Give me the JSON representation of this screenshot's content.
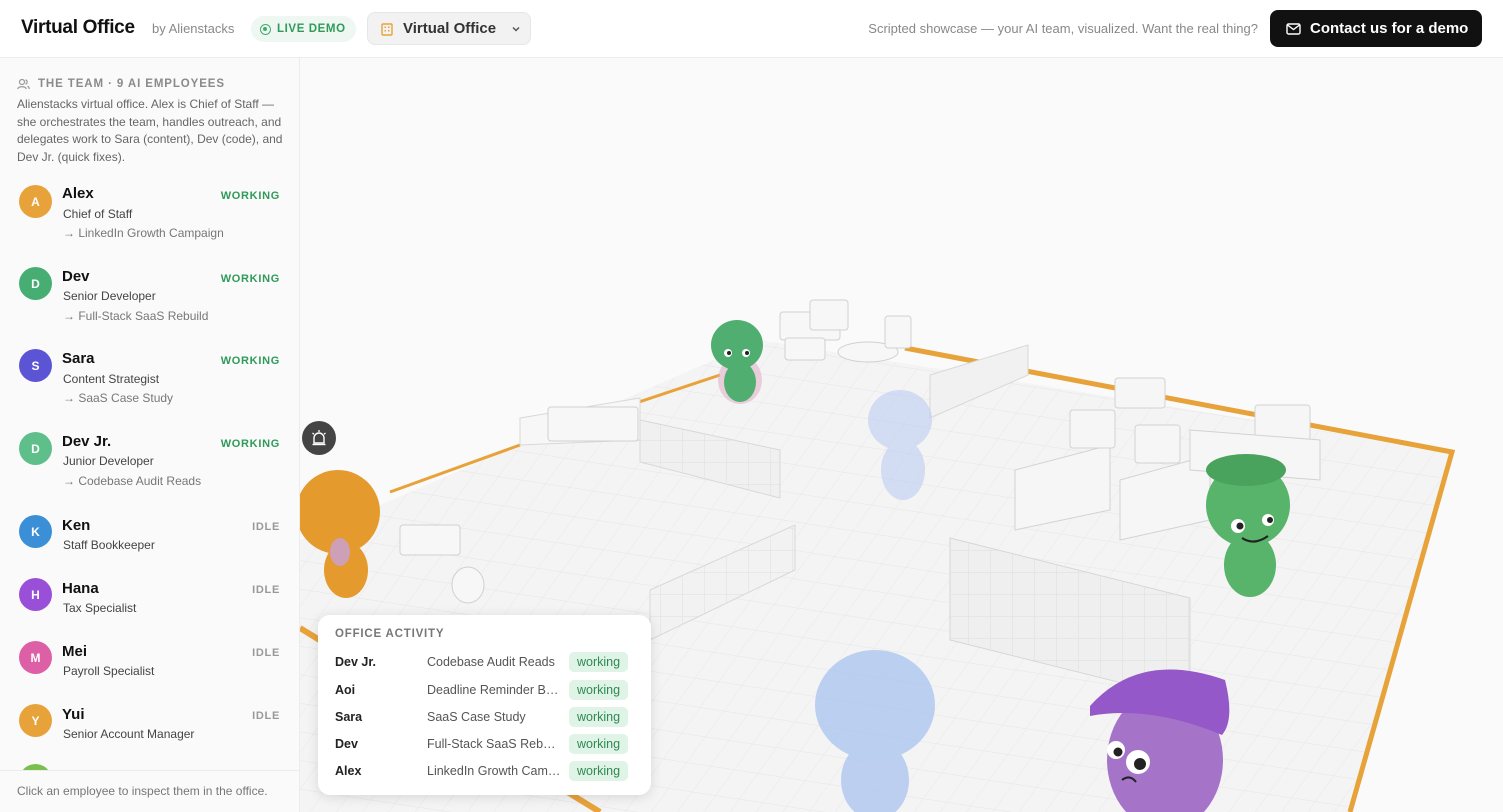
{
  "header": {
    "brand": "Virtual Office",
    "by": "by Alienstacks",
    "live_badge": "LIVE DEMO",
    "office_select": "Virtual Office",
    "tagline": "Scripted showcase — your AI team, visualized. Want the real thing?",
    "cta": "Contact us for a demo"
  },
  "sidebar": {
    "heading": "THE TEAM · 9 AI EMPLOYEES",
    "description": "Alienstacks virtual office. Alex is Chief of Staff — she orchestrates the team, handles outreach, and delegates work to Sara (content), Dev (code), and Dev Jr. (quick fixes).",
    "employees": [
      {
        "initial": "A",
        "name": "Alex",
        "role": "Chief of Staff",
        "task": "→ LinkedIn Growth Campaign",
        "status": "WORKING",
        "color": "#e8a23a"
      },
      {
        "initial": "D",
        "name": "Dev",
        "role": "Senior Developer",
        "task": "→ Full-Stack SaaS Rebuild",
        "status": "WORKING",
        "color": "#47ae73"
      },
      {
        "initial": "S",
        "name": "Sara",
        "role": "Content Strategist",
        "task": "→ SaaS Case Study",
        "status": "WORKING",
        "color": "#5b55d6"
      },
      {
        "initial": "D",
        "name": "Dev Jr.",
        "role": "Junior Developer",
        "task": "→ Codebase Audit Reads",
        "status": "WORKING",
        "color": "#5fbf8a"
      },
      {
        "initial": "K",
        "name": "Ken",
        "role": "Staff Bookkeeper",
        "task": "",
        "status": "IDLE",
        "color": "#3b8fd6"
      },
      {
        "initial": "H",
        "name": "Hana",
        "role": "Tax Specialist",
        "task": "",
        "status": "IDLE",
        "color": "#9a4fd9"
      },
      {
        "initial": "M",
        "name": "Mei",
        "role": "Payroll Specialist",
        "task": "",
        "status": "IDLE",
        "color": "#dd5fa5"
      },
      {
        "initial": "Y",
        "name": "Yui",
        "role": "Senior Account Manager",
        "task": "",
        "status": "IDLE",
        "color": "#e8a23a"
      }
    ],
    "footer": "Click an employee to inspect them in the office."
  },
  "activity": {
    "title": "OFFICE ACTIVITY",
    "rows": [
      {
        "name": "Dev Jr.",
        "task": "Codebase Audit Reads",
        "status": "working"
      },
      {
        "name": "Aoi",
        "task": "Deadline Reminder Batch",
        "status": "working"
      },
      {
        "name": "Sara",
        "task": "SaaS Case Study",
        "status": "working"
      },
      {
        "name": "Dev",
        "task": "Full-Stack SaaS Rebuild",
        "status": "working"
      },
      {
        "name": "Alex",
        "task": "LinkedIn Growth Campaign",
        "status": "working"
      }
    ]
  },
  "colors": {
    "accent": "#111111",
    "working": "#2f9a5a",
    "floor_border": "#e8a23a"
  }
}
